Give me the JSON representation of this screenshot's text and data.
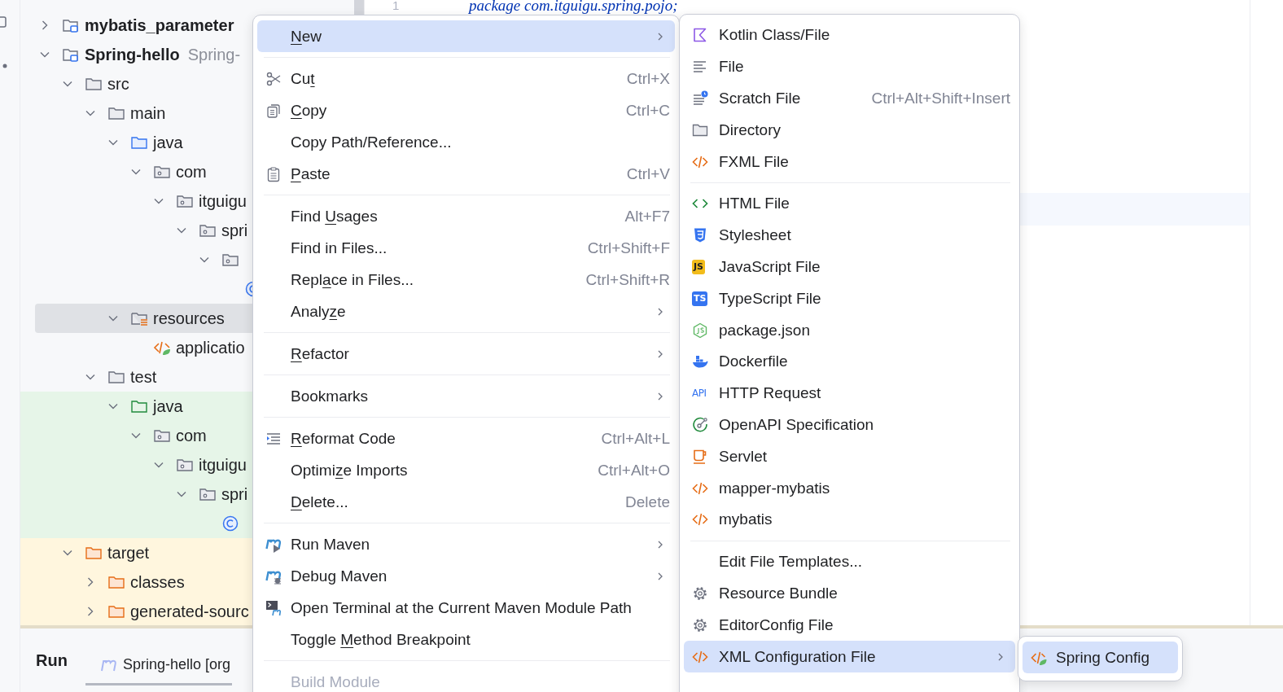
{
  "project_tree": {
    "nodes": [
      {
        "label": "mybatis_parameter",
        "kind": "module",
        "expanded": false,
        "selected": false
      },
      {
        "label": "Spring-hello",
        "secondary": "Spring-",
        "kind": "module",
        "expanded": true,
        "selected": false,
        "children": [
          {
            "label": "src",
            "kind": "folder",
            "expanded": true,
            "selected": false,
            "children": [
              {
                "label": "main",
                "kind": "folder",
                "expanded": true,
                "selected": false,
                "children": [
                  {
                    "label": "java",
                    "kind": "source",
                    "expanded": true,
                    "selected": false,
                    "children": [
                      {
                        "label": "com",
                        "kind": "package",
                        "expanded": true,
                        "selected": false,
                        "children": [
                          {
                            "label": "itguigu",
                            "kind": "package",
                            "expanded": true,
                            "selected": false,
                            "children": [
                              {
                                "label": "spri",
                                "kind": "package",
                                "expanded": true,
                                "selected": false,
                                "children": [
                                  {
                                    "kind": "package",
                                    "expanded": true,
                                    "selected": false,
                                    "children": [
                                      {
                                        "kind": "class",
                                        "selected": false
                                      }
                                    ]
                                  }
                                ]
                              }
                            ]
                          }
                        ]
                      }
                    ]
                  },
                  {
                    "label": "resources",
                    "kind": "resources",
                    "expanded": true,
                    "selected": true,
                    "children": [
                      {
                        "label": "applicatio",
                        "kind": "spring-xml",
                        "selected": false
                      }
                    ]
                  }
                ]
              },
              {
                "label": "test",
                "kind": "folder",
                "expanded": true,
                "selected": false,
                "children": [
                  {
                    "label": "java",
                    "kind": "test-source",
                    "expanded": true,
                    "selected": false,
                    "children": [
                      {
                        "label": "com",
                        "kind": "package",
                        "expanded": true,
                        "selected": false,
                        "children": [
                          {
                            "label": "itguigu",
                            "kind": "package",
                            "expanded": true,
                            "selected": false,
                            "children": [
                              {
                                "label": "spri",
                                "kind": "package",
                                "expanded": true,
                                "selected": false,
                                "children": [
                                  {
                                    "kind": "class",
                                    "selected": false
                                  }
                                ]
                              }
                            ]
                          }
                        ]
                      }
                    ]
                  }
                ]
              }
            ]
          },
          {
            "label": "target",
            "kind": "excluded",
            "expanded": true,
            "selected": false,
            "children": [
              {
                "label": "classes",
                "kind": "excluded",
                "expanded": false,
                "selected": false
              },
              {
                "label": "generated-sourc",
                "kind": "excluded",
                "expanded": false,
                "selected": false
              }
            ]
          }
        ]
      }
    ]
  },
  "editor": {
    "line_number": "1",
    "code": "package com.itguigu.spring.pojo;"
  },
  "run_panel": {
    "title": "Run",
    "tabs": [
      {
        "label": "Spring-hello [org",
        "selected": true
      }
    ]
  },
  "context_menu": {
    "items": [
      {
        "kind": "item",
        "label": {
          "key": "N",
          "post": "ew"
        },
        "submenu": true,
        "selected": true,
        "disabled": false
      },
      {
        "kind": "separator"
      },
      {
        "kind": "item",
        "label": {
          "pre": "Cu",
          "key": "t"
        },
        "shortcut": "Ctrl+X",
        "submenu": false,
        "selected": false,
        "disabled": false
      },
      {
        "kind": "item",
        "label": {
          "key": "C",
          "post": "opy"
        },
        "shortcut": "Ctrl+C",
        "submenu": false,
        "selected": false,
        "disabled": false
      },
      {
        "kind": "item",
        "label": {
          "pre": "Copy Path/Reference..."
        },
        "submenu": false,
        "selected": false,
        "disabled": false
      },
      {
        "kind": "item",
        "label": {
          "key": "P",
          "post": "aste"
        },
        "shortcut": "Ctrl+V",
        "submenu": false,
        "selected": false,
        "disabled": false
      },
      {
        "kind": "separator"
      },
      {
        "kind": "item",
        "label": {
          "pre": "Find ",
          "key": "U",
          "post": "sages"
        },
        "shortcut": "Alt+F7",
        "submenu": false,
        "selected": false,
        "disabled": false
      },
      {
        "kind": "item",
        "label": {
          "pre": "Find in Files..."
        },
        "shortcut": "Ctrl+Shift+F",
        "submenu": false,
        "selected": false,
        "disabled": false
      },
      {
        "kind": "item",
        "label": {
          "pre": "Repl",
          "key": "a",
          "post": "ce in Files..."
        },
        "shortcut": "Ctrl+Shift+R",
        "submenu": false,
        "selected": false,
        "disabled": false
      },
      {
        "kind": "item",
        "label": {
          "pre": "Analy",
          "key": "z",
          "post": "e"
        },
        "submenu": true,
        "selected": false,
        "disabled": false
      },
      {
        "kind": "separator"
      },
      {
        "kind": "item",
        "label": {
          "key": "R",
          "post": "efactor"
        },
        "submenu": true,
        "selected": false,
        "disabled": false
      },
      {
        "kind": "separator"
      },
      {
        "kind": "item",
        "label": {
          "pre": "Bookmarks"
        },
        "submenu": true,
        "selected": false,
        "disabled": false
      },
      {
        "kind": "separator"
      },
      {
        "kind": "item",
        "label": {
          "key": "R",
          "post": "eformat Code"
        },
        "shortcut": "Ctrl+Alt+L",
        "submenu": false,
        "selected": false,
        "disabled": false
      },
      {
        "kind": "item",
        "label": {
          "pre": "Optimi",
          "key": "z",
          "post": "e Imports"
        },
        "shortcut": "Ctrl+Alt+O",
        "submenu": false,
        "selected": false,
        "disabled": false
      },
      {
        "kind": "item",
        "label": {
          "key": "D",
          "post": "elete..."
        },
        "shortcut": "Delete",
        "submenu": false,
        "selected": false,
        "disabled": false
      },
      {
        "kind": "separator"
      },
      {
        "kind": "item",
        "label": {
          "pre": "Run Maven"
        },
        "submenu": true,
        "selected": false,
        "disabled": false
      },
      {
        "kind": "item",
        "label": {
          "pre": "Debug Maven"
        },
        "submenu": true,
        "selected": false,
        "disabled": false
      },
      {
        "kind": "item",
        "label": {
          "pre": "Open Terminal at the Current Maven Module Path"
        },
        "submenu": false,
        "selected": false,
        "disabled": false
      },
      {
        "kind": "item",
        "label": {
          "pre": "Toggle ",
          "key": "M",
          "post": "ethod Breakpoint"
        },
        "submenu": false,
        "selected": false,
        "disabled": false
      },
      {
        "kind": "separator"
      },
      {
        "kind": "item",
        "label": {
          "pre": "Build Module"
        },
        "submenu": false,
        "selected": false,
        "disabled": true
      }
    ]
  },
  "new_submenu": {
    "items": [
      {
        "kind": "item",
        "label": "Kotlin Class/File",
        "submenu": false,
        "selected": false
      },
      {
        "kind": "item",
        "label": "File",
        "submenu": false,
        "selected": false
      },
      {
        "kind": "item",
        "label": "Scratch File",
        "shortcut": "Ctrl+Alt+Shift+Insert",
        "submenu": false,
        "selected": false
      },
      {
        "kind": "item",
        "label": "Directory",
        "submenu": false,
        "selected": false
      },
      {
        "kind": "item",
        "label": "FXML File",
        "submenu": false,
        "selected": false
      },
      {
        "kind": "separator"
      },
      {
        "kind": "item",
        "label": "HTML File",
        "submenu": false,
        "selected": false
      },
      {
        "kind": "item",
        "label": "Stylesheet",
        "submenu": false,
        "selected": false
      },
      {
        "kind": "item",
        "label": "JavaScript File",
        "badge": "JS",
        "submenu": false,
        "selected": false
      },
      {
        "kind": "item",
        "label": "TypeScript File",
        "badge": "TS",
        "submenu": false,
        "selected": false
      },
      {
        "kind": "item",
        "label": "package.json",
        "submenu": false,
        "selected": false
      },
      {
        "kind": "item",
        "label": "Dockerfile",
        "submenu": false,
        "selected": false
      },
      {
        "kind": "item",
        "label": "HTTP Request",
        "badge": "API",
        "submenu": false,
        "selected": false
      },
      {
        "kind": "item",
        "label": "OpenAPI Specification",
        "submenu": false,
        "selected": false
      },
      {
        "kind": "item",
        "label": "Servlet",
        "submenu": false,
        "selected": false
      },
      {
        "kind": "item",
        "label": "mapper-mybatis",
        "submenu": false,
        "selected": false
      },
      {
        "kind": "item",
        "label": "mybatis",
        "submenu": false,
        "selected": false
      },
      {
        "kind": "separator"
      },
      {
        "kind": "item",
        "label": "Edit File Templates...",
        "submenu": false,
        "selected": false
      },
      {
        "kind": "item",
        "label": "Resource Bundle",
        "submenu": false,
        "selected": false
      },
      {
        "kind": "item",
        "label": "EditorConfig File",
        "submenu": false,
        "selected": false
      },
      {
        "kind": "item",
        "label": "XML Configuration File",
        "submenu": true,
        "selected": true
      }
    ]
  },
  "xml_submenu": {
    "items": [
      {
        "label": "Spring Config",
        "selected": true
      }
    ]
  }
}
